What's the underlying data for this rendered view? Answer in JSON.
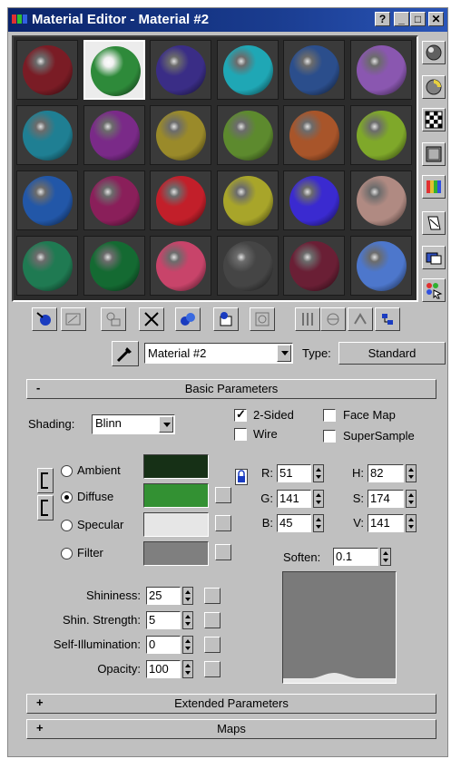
{
  "window": {
    "title": "Material Editor - Material #2",
    "buttons": {
      "help": "?",
      "minimize": "_",
      "maximize": "□",
      "close": "✕"
    }
  },
  "sample_slots": {
    "colors": [
      [
        "#7a1c25",
        "#2e8a3a",
        "#3a2d86",
        "#1fa7b5",
        "#2b4e8c",
        "#8a57b0"
      ],
      [
        "#1f7f93",
        "#7a2a88",
        "#9a8a2a",
        "#5d8a2e",
        "#a8552a",
        "#7fa82a"
      ],
      [
        "#2257a8",
        "#8a1f5a",
        "#c21f2a",
        "#a8a52a",
        "#3a2ad0",
        "#b08a82"
      ],
      [
        "#1f7a52",
        "#146a32",
        "#c8446a",
        "#454545",
        "#6a1f35",
        "#4d77cc"
      ]
    ],
    "selected": "slot-2"
  },
  "side_toolbar": [
    "sample-type-icon",
    "backlight-icon",
    "background-icon",
    "sample-uv-tiling-icon",
    "video-color-check-icon",
    "make-preview-icon",
    "options-icon",
    "select-by-material-icon"
  ],
  "bottom_toolbar": [
    "get-material-icon",
    "put-to-scene-icon",
    "assign-to-selection-icon",
    "reset-map-icon",
    "make-unique-icon",
    "put-to-library-icon",
    "material-effects-channel-icon",
    "show-map-in-viewport-icon",
    "show-end-result-icon",
    "go-to-parent-icon",
    "go-forward-to-sibling-icon"
  ],
  "material": {
    "name": "Material #2",
    "type_label": "Type:",
    "type_value": "Standard"
  },
  "rollouts": {
    "basic": {
      "sign": "-",
      "title": "Basic Parameters"
    },
    "extended": {
      "sign": "+",
      "title": "Extended Parameters"
    },
    "maps": {
      "sign": "+",
      "title": "Maps"
    }
  },
  "basic": {
    "shading_label": "Shading:",
    "shading_value": "Blinn",
    "two_sided": {
      "label": "2-Sided",
      "checked": true
    },
    "wire": {
      "label": "Wire",
      "checked": false
    },
    "face_map": {
      "label": "Face Map",
      "checked": false
    },
    "supersample": {
      "label": "SuperSample",
      "checked": false
    },
    "components": [
      {
        "label": "Ambient",
        "color": "#163016",
        "selected": false
      },
      {
        "label": "Diffuse",
        "color": "#339133",
        "selected": true
      },
      {
        "label": "Specular",
        "color": "#e6e6e6",
        "selected": false
      },
      {
        "label": "Filter",
        "color": "#7f7f7f",
        "selected": false
      }
    ],
    "rgb": {
      "r_label": "R:",
      "r": "51",
      "g_label": "G:",
      "g": "141",
      "b_label": "B:",
      "b": "45"
    },
    "hsv": {
      "h_label": "H:",
      "h": "82",
      "s_label": "S:",
      "s": "174",
      "v_label": "V:",
      "v": "141"
    },
    "soften_label": "Soften:",
    "soften": "0.1",
    "shininess": {
      "label": "Shininess:",
      "value": "25"
    },
    "shin_strength": {
      "label": "Shin. Strength:",
      "value": "5"
    },
    "self_illum": {
      "label": "Self-Illumination:",
      "value": "0"
    },
    "opacity": {
      "label": "Opacity:",
      "value": "100"
    }
  }
}
